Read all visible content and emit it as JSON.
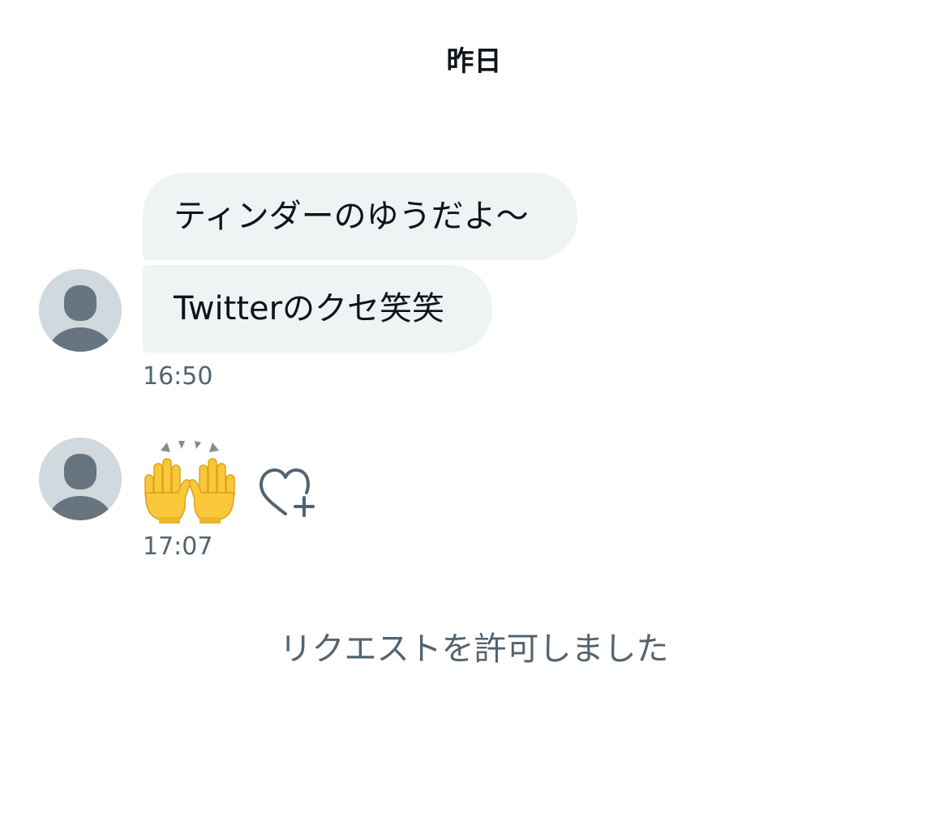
{
  "conversation": {
    "date_header": "昨日",
    "groups": [
      {
        "messages": [
          {
            "text": "ティンダーのゆうだよ〜"
          },
          {
            "text": "Twitterのクセ笑笑"
          }
        ],
        "time": "16:50"
      },
      {
        "messages": [
          {
            "emoji": "raising-hands-emoji"
          }
        ],
        "time": "17:07"
      }
    ],
    "system_message": "リクエストを許可しました"
  },
  "colors": {
    "bubble_background": "#eff3f4",
    "secondary_text": "#536471",
    "avatar_background": "#cfd9de",
    "avatar_figure": "#66757f",
    "emoji_yellow": "#f8c73a"
  }
}
